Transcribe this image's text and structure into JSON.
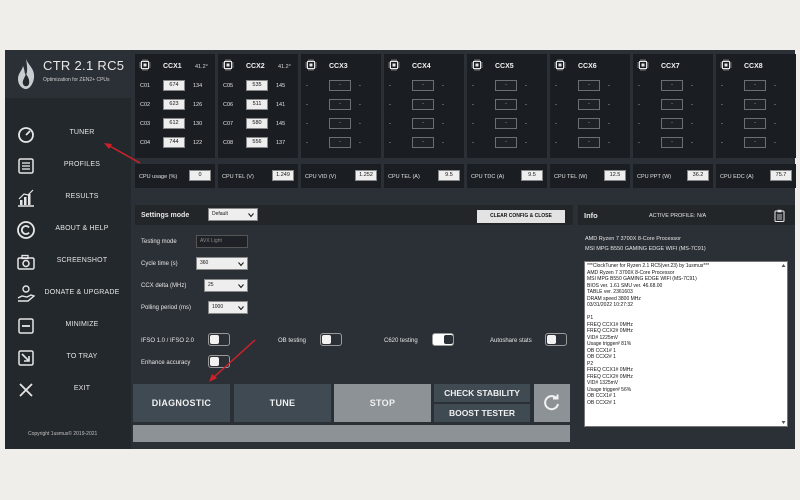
{
  "app": {
    "title": "CTR 2.1 RC5",
    "subtitle": "Optimization for ZEN2+ CPUs",
    "copyright": "Copyright 1usmus© 2019-2021"
  },
  "nav": [
    {
      "label": "TUNER",
      "icon": "speedometer-icon"
    },
    {
      "label": "PROFILES",
      "icon": "list-icon"
    },
    {
      "label": "RESULTS",
      "icon": "bar-chart-icon"
    },
    {
      "label": "ABOUT & HELP",
      "icon": "copyright-icon"
    },
    {
      "label": "SCREENSHOT",
      "icon": "camera-icon"
    },
    {
      "label": "DONATE & UPGRADE",
      "icon": "donate-hand-icon"
    },
    {
      "label": "MINIMIZE",
      "icon": "minimize-icon"
    },
    {
      "label": "TO TRAY",
      "icon": "tray-arrow-icon"
    },
    {
      "label": "EXIT",
      "icon": "close-x-icon"
    }
  ],
  "ccx": [
    {
      "name": "CCX1",
      "temp": "41.2°",
      "cores": [
        [
          "C01",
          "674",
          "134"
        ],
        [
          "C02",
          "623",
          "126"
        ],
        [
          "C03",
          "612",
          "130"
        ],
        [
          "C04",
          "744",
          "122"
        ]
      ]
    },
    {
      "name": "CCX2",
      "temp": "41.2°",
      "cores": [
        [
          "C05",
          "535",
          "145"
        ],
        [
          "C06",
          "511",
          "141"
        ],
        [
          "C07",
          "580",
          "145"
        ],
        [
          "C08",
          "556",
          "137"
        ]
      ]
    },
    {
      "name": "CCX3",
      "temp": "",
      "cores": [
        [
          "-",
          "-",
          "-"
        ],
        [
          "-",
          "-",
          "-"
        ],
        [
          "-",
          "-",
          "-"
        ],
        [
          "-",
          "-",
          "-"
        ]
      ]
    },
    {
      "name": "CCX4",
      "temp": "",
      "cores": [
        [
          "-",
          "-",
          "-"
        ],
        [
          "-",
          "-",
          "-"
        ],
        [
          "-",
          "-",
          "-"
        ],
        [
          "-",
          "-",
          "-"
        ]
      ]
    },
    {
      "name": "CCX5",
      "temp": "",
      "cores": [
        [
          "-",
          "-",
          "-"
        ],
        [
          "-",
          "-",
          "-"
        ],
        [
          "-",
          "-",
          "-"
        ],
        [
          "-",
          "-",
          "-"
        ]
      ]
    },
    {
      "name": "CCX6",
      "temp": "",
      "cores": [
        [
          "-",
          "-",
          "-"
        ],
        [
          "-",
          "-",
          "-"
        ],
        [
          "-",
          "-",
          "-"
        ],
        [
          "-",
          "-",
          "-"
        ]
      ]
    },
    {
      "name": "CCX7",
      "temp": "",
      "cores": [
        [
          "-",
          "-",
          "-"
        ],
        [
          "-",
          "-",
          "-"
        ],
        [
          "-",
          "-",
          "-"
        ],
        [
          "-",
          "-",
          "-"
        ]
      ]
    },
    {
      "name": "CCX8",
      "temp": "",
      "cores": [
        [
          "-",
          "-",
          "-"
        ],
        [
          "-",
          "-",
          "-"
        ],
        [
          "-",
          "-",
          "-"
        ],
        [
          "-",
          "-",
          "-"
        ]
      ]
    }
  ],
  "telemetry": [
    {
      "label": "CPU usage (%)",
      "value": "0"
    },
    {
      "label": "CPU TEL (V)",
      "value": "1.249"
    },
    {
      "label": "CPU VID (V)",
      "value": "1.252"
    },
    {
      "label": "CPU TEL (A)",
      "value": "9.5"
    },
    {
      "label": "CPU TDC (A)",
      "value": "9.5"
    },
    {
      "label": "CPU TEL (W)",
      "value": "12.5"
    },
    {
      "label": "CPU PPT (W)",
      "value": "36.2"
    },
    {
      "label": "CPU EDC (A)",
      "value": "75.7"
    }
  ],
  "settings": {
    "title": "Settings mode",
    "mode_value": "Default",
    "clear_label": "CLEAR CONFIG & CLOSE",
    "testing_mode_label": "Testing mode",
    "testing_mode_value": "AVX Light",
    "cycle_time_label": "Cycle time (s)",
    "cycle_time_value": "360",
    "ccx_delta_label": "CCX delta (MHz)",
    "ccx_delta_value": "25",
    "polling_label": "Polling period (ms)",
    "polling_value": "1000",
    "ifso_label": "IFSO 1.0 / IFSO 2.0",
    "ob_label": "OB testing",
    "c620_label": "C620 testing",
    "autoshare_label": "Autoshare stats",
    "enhance_label": "Enhance accuracy"
  },
  "toggles": {
    "ifso": false,
    "ob": false,
    "c620": true,
    "autoshare": false,
    "enhance": false
  },
  "buttons": {
    "diagnostic": "DIAGNOSTIC",
    "tune": "TUNE",
    "stop": "STOP",
    "check_stability": "CHECK STABILITY",
    "boost_tester": "BOOST TESTER"
  },
  "info": {
    "title": "Info",
    "active_profile": "ACTIVE PROFILE: N/A",
    "cpu": "AMD Ryzen 7 3700X 8-Core Processor",
    "board": "MSI MPG B550 GAMING EDGE WIFI (MS-7C91)",
    "log": [
      "***ClockTuner for Ryzen 2.1 RC5(ver.23) by 1usmus***",
      "AMD Ryzen 7 3700X 8-Core Processor",
      "MSI MPG B550 GAMING EDGE WIFI (MS-7C91)",
      "BIOS ver. 1.61 SMU ver. 46.68.00",
      "TABLE ver. 2361603",
      "DRAM speed 3800 MHz",
      "03/31/2022 10:27:32",
      "",
      "P1",
      "FREQ CCX1# 0MHz",
      "FREQ CCX2# 0MHz",
      "VID# 1225mV",
      "Usage trigger# 81%",
      "OB CCX1# 1",
      "OB CCX2# 1",
      "P2",
      "FREQ CCX1# 0MHz",
      "FREQ CCX2# 0MHz",
      "VID# 1325mV",
      "Usage trigger# 56%",
      "OB CCX1# 1",
      "OB CCX2# 1"
    ]
  },
  "colors": {
    "accent_arrow": "#d0202a",
    "panel_bg": "#2b3036",
    "button_bg": "#3f4a52",
    "stop_bg": "#8d9296"
  }
}
